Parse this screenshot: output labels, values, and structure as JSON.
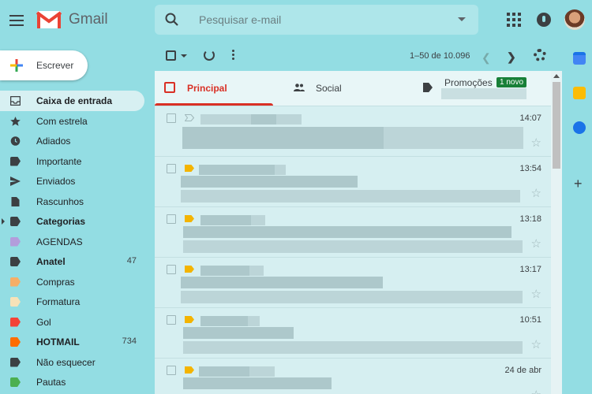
{
  "app": {
    "name": "Gmail"
  },
  "search": {
    "placeholder": "Pesquisar e-mail"
  },
  "compose": {
    "label": "Escrever"
  },
  "sidebar": {
    "items": [
      {
        "label": "Caixa de entrada",
        "icon": "inbox-icon",
        "active": true,
        "bold": true,
        "count": "",
        "color": "#3c4043"
      },
      {
        "label": "Com estrela",
        "icon": "star-icon",
        "count": "",
        "color": "#3c4043"
      },
      {
        "label": "Adiados",
        "icon": "clock-icon",
        "count": "",
        "color": "#3c4043"
      },
      {
        "label": "Importante",
        "icon": "important-icon",
        "count": "",
        "color": "#3c4043"
      },
      {
        "label": "Enviados",
        "icon": "send-icon",
        "count": "",
        "color": "#3c4043"
      },
      {
        "label": "Rascunhos",
        "icon": "draft-icon",
        "count": "",
        "color": "#3c4043"
      },
      {
        "label": "Categorias",
        "icon": "label-icon",
        "bold": true,
        "count": "",
        "color": "#3c4043",
        "expand": true
      },
      {
        "label": "AGENDAS",
        "icon": "label-icon",
        "count": "",
        "color": "#b39ddb"
      },
      {
        "label": "Anatel",
        "icon": "label-icon",
        "bold": true,
        "count": "47",
        "color": "#3c4043"
      },
      {
        "label": "Compras",
        "icon": "label-icon",
        "count": "",
        "color": "#f6ae67"
      },
      {
        "label": "Formatura",
        "icon": "label-icon",
        "count": "",
        "color": "#f7e2b8"
      },
      {
        "label": "Gol",
        "icon": "label-icon",
        "count": "",
        "color": "#f44336"
      },
      {
        "label": "HOTMAIL",
        "icon": "label-icon",
        "bold": true,
        "count": "734",
        "color": "#ff6d00"
      },
      {
        "label": "Não esquecer",
        "icon": "label-icon",
        "count": "",
        "color": "#3c4043"
      },
      {
        "label": "Pautas",
        "icon": "label-icon",
        "count": "",
        "color": "#4caf50"
      }
    ]
  },
  "toolbar": {
    "range": "1–50 de 10.096"
  },
  "tabs": [
    {
      "label": "Principal",
      "active": true
    },
    {
      "label": "Social"
    },
    {
      "label": "Promoções",
      "badge": "1 novo"
    }
  ],
  "emails": [
    {
      "time": "14:07",
      "important": false
    },
    {
      "time": "13:54",
      "important": true
    },
    {
      "time": "13:18",
      "important": true
    },
    {
      "time": "13:17",
      "important": true
    },
    {
      "time": "10:51",
      "important": true
    },
    {
      "time": "24 de abr",
      "important": true
    }
  ],
  "colors": {
    "accent": "#d93025",
    "background": "#93dde3",
    "important": "#f4b400"
  }
}
